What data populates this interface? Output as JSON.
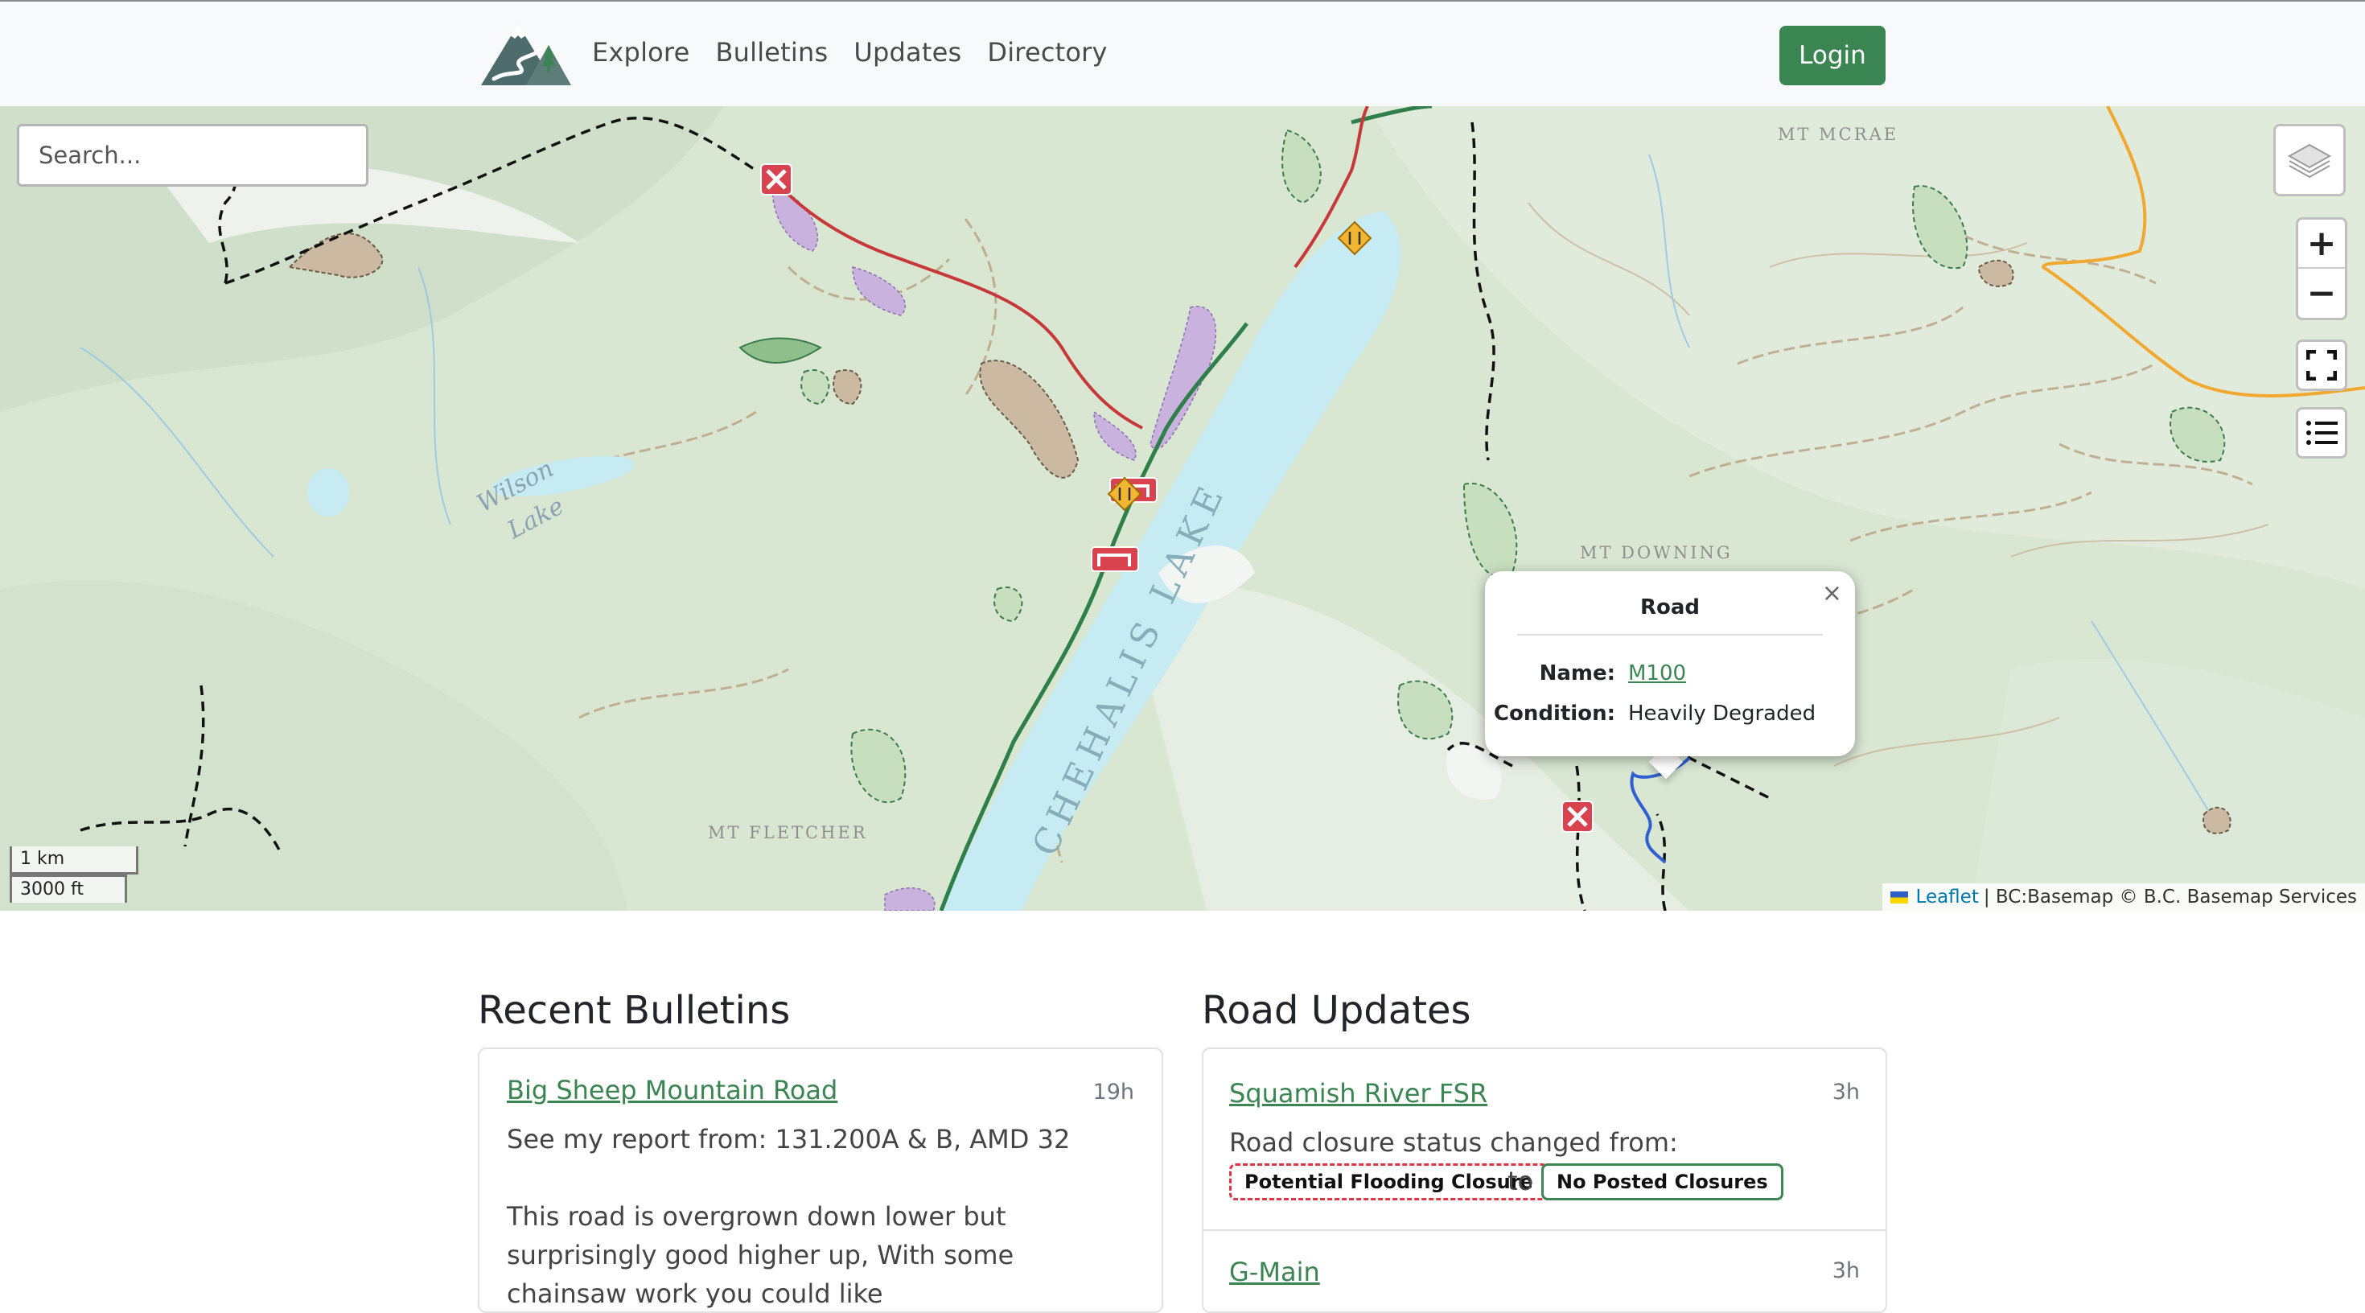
{
  "nav": {
    "links": [
      "Explore",
      "Bulletins",
      "Updates",
      "Directory"
    ],
    "login_label": "Login"
  },
  "map": {
    "search_placeholder": "Search...",
    "zoom_in_label": "+",
    "zoom_out_label": "−",
    "scale_metric": "1 km",
    "scale_imperial": "3000 ft",
    "attribution_link": "Leaflet",
    "attribution_text": "| BC:Basemap © B.C. Basemap Services",
    "labels": {
      "lake": "CHEHALIS LAKE",
      "wilson_1": "Wilson",
      "wilson_2": "Lake",
      "mt_mcrae": "MT MCRAE",
      "mt_downing": "MT DOWNING",
      "mt_fletcher": "MT FLETCHER"
    },
    "popup": {
      "title": "Road",
      "close": "×",
      "name_label": "Name:",
      "name_value": "M100",
      "condition_label": "Condition:",
      "condition_value": "Heavily Degraded"
    },
    "colors": {
      "accent_green": "#3a8551",
      "closure_red": "#d9434f",
      "road_red": "#c73838",
      "road_green": "#2f7f4a",
      "road_orange": "#f0a830",
      "road_blue": "#2f5fd0",
      "lake": "#c7ebf2"
    }
  },
  "bulletins": {
    "title": "Recent Bulletins",
    "items": [
      {
        "name": "Big Sheep Mountain Road",
        "time": "19h",
        "line1": "See my report from: 131.200A & B, AMD 32",
        "line2": "This road is overgrown down lower but",
        "line3": "surprisingly good higher up, With some",
        "line4": "chainsaw work you could like"
      }
    ]
  },
  "updates": {
    "title": "Road Updates",
    "items": [
      {
        "name": "Squamish River FSR",
        "time": "3h",
        "text": "Road closure status changed from:",
        "from": "Potential Flooding Closure",
        "to_word": "to",
        "to": "No Posted Closures"
      },
      {
        "name": "G-Main",
        "time": "3h"
      }
    ]
  }
}
